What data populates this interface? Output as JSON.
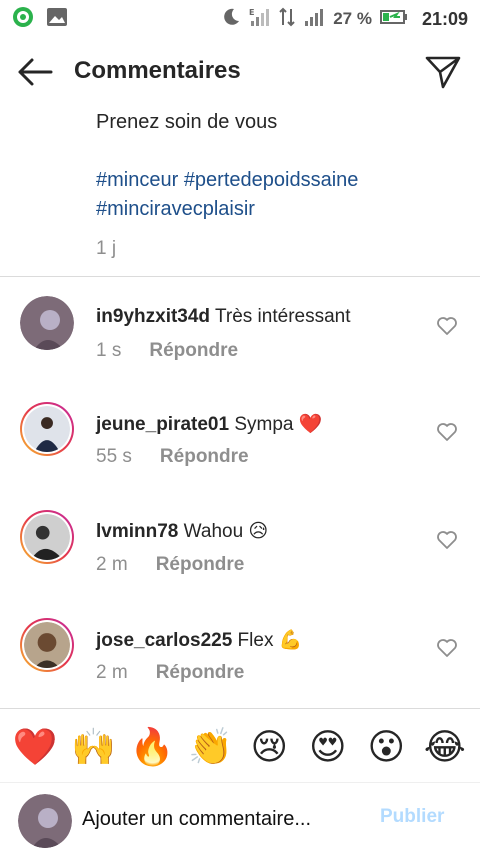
{
  "status_bar": {
    "battery_percent": "27 %",
    "time": "21:09",
    "network_label": "E"
  },
  "header": {
    "title": "Commentaires"
  },
  "post": {
    "caption_line": "Prenez soin de vous",
    "hashtags_line1": "#minceur #pertedepoidssaine",
    "hashtags_line2": "#minciravecplaisir",
    "age": "1 j"
  },
  "comments": [
    {
      "username": "in9yhzxit34d",
      "text": "Très intéressant",
      "time": "1 s",
      "reply_label": "Répondre",
      "story_ring": false,
      "avatar_color": "#7d6b78"
    },
    {
      "username": "jeune_pirate01",
      "text": "Sympa ❤️",
      "time": "55 s",
      "reply_label": "Répondre",
      "story_ring": true,
      "avatar_color": "#5a5f7a"
    },
    {
      "username": "lvminn78",
      "text": "Wahou 😥",
      "time": "2 m",
      "reply_label": "Répondre",
      "story_ring": true,
      "avatar_color": "#444444"
    },
    {
      "username": "jose_carlos225",
      "text": "Flex 💪",
      "time": "2 m",
      "reply_label": "Répondre",
      "story_ring": true,
      "avatar_color": "#6b5a4a"
    }
  ],
  "emoji_bar": [
    "❤️",
    "🙌",
    "🔥",
    "👏",
    "😢",
    "😍",
    "😮",
    "😂"
  ],
  "compose": {
    "placeholder": "Ajouter un commentaire...",
    "publish_label": "Publier"
  },
  "colors": {
    "hashtag": "#1e4f8a",
    "muted": "#8e8e8e",
    "publish_disabled": "#b3dbff",
    "story_ring": [
      "#f9c02c",
      "#e4364b",
      "#c42aa3"
    ]
  }
}
